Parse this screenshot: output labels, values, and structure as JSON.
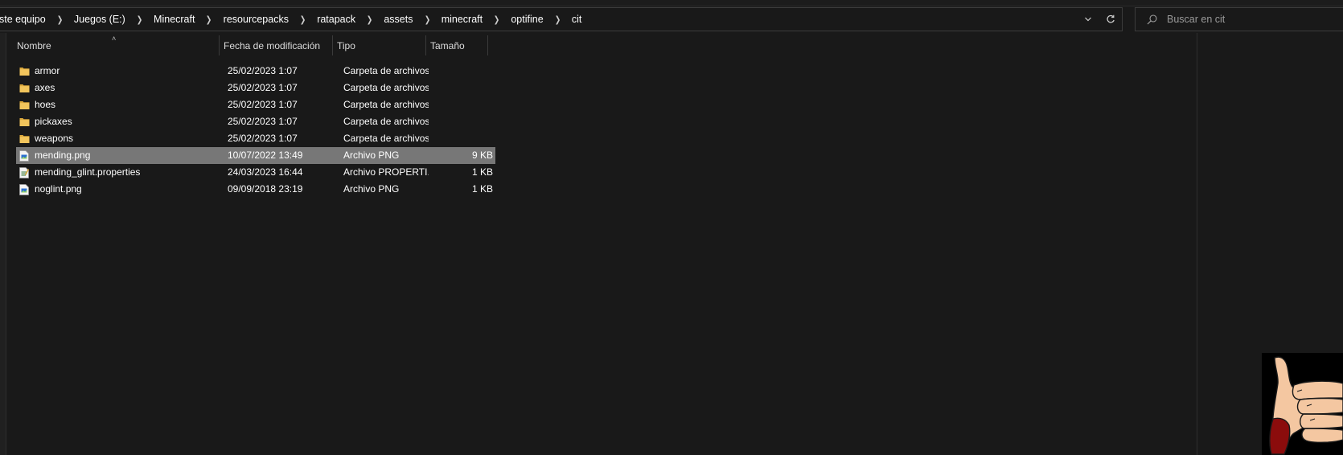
{
  "breadcrumb": [
    {
      "label": "ste equipo",
      "name": "breadcrumb-este-equipo"
    },
    {
      "label": "Juegos (E:)",
      "name": "breadcrumb-juegos"
    },
    {
      "label": "Minecraft",
      "name": "breadcrumb-minecraft"
    },
    {
      "label": "resourcepacks",
      "name": "breadcrumb-resourcepacks"
    },
    {
      "label": "ratapack",
      "name": "breadcrumb-ratapack"
    },
    {
      "label": "assets",
      "name": "breadcrumb-assets"
    },
    {
      "label": "minecraft",
      "name": "breadcrumb-minecraft-sub"
    },
    {
      "label": "optifine",
      "name": "breadcrumb-optifine"
    },
    {
      "label": "cit",
      "name": "breadcrumb-cit"
    }
  ],
  "search": {
    "placeholder": "Buscar en cit",
    "value": ""
  },
  "columns": {
    "name": "Nombre",
    "date": "Fecha de modificación",
    "type": "Tipo",
    "size": "Tamaño"
  },
  "files": [
    {
      "name": "armor",
      "date": "25/02/2023 1:07",
      "type": "Carpeta de archivos",
      "size": "",
      "icon": "folder-icon",
      "selected": false
    },
    {
      "name": "axes",
      "date": "25/02/2023 1:07",
      "type": "Carpeta de archivos",
      "size": "",
      "icon": "folder-icon",
      "selected": false
    },
    {
      "name": "hoes",
      "date": "25/02/2023 1:07",
      "type": "Carpeta de archivos",
      "size": "",
      "icon": "folder-icon",
      "selected": false
    },
    {
      "name": "pickaxes",
      "date": "25/02/2023 1:07",
      "type": "Carpeta de archivos",
      "size": "",
      "icon": "folder-icon",
      "selected": false
    },
    {
      "name": "weapons",
      "date": "25/02/2023 1:07",
      "type": "Carpeta de archivos",
      "size": "",
      "icon": "folder-icon",
      "selected": false
    },
    {
      "name": "mending.png",
      "date": "10/07/2022 13:49",
      "type": "Archivo PNG",
      "size": "9 KB",
      "icon": "png-file-icon",
      "selected": true
    },
    {
      "name": "mending_glint.properties",
      "date": "24/03/2023 16:44",
      "type": "Archivo PROPERTI...",
      "size": "1 KB",
      "icon": "properties-file-icon",
      "selected": false
    },
    {
      "name": "noglint.png",
      "date": "09/09/2018 23:19",
      "type": "Archivo PNG",
      "size": "1 KB",
      "icon": "png-file-icon",
      "selected": false
    }
  ],
  "colors": {
    "background": "#191919",
    "selection": "#777777",
    "folder": "#f2c55c",
    "text": "#ffffff"
  }
}
